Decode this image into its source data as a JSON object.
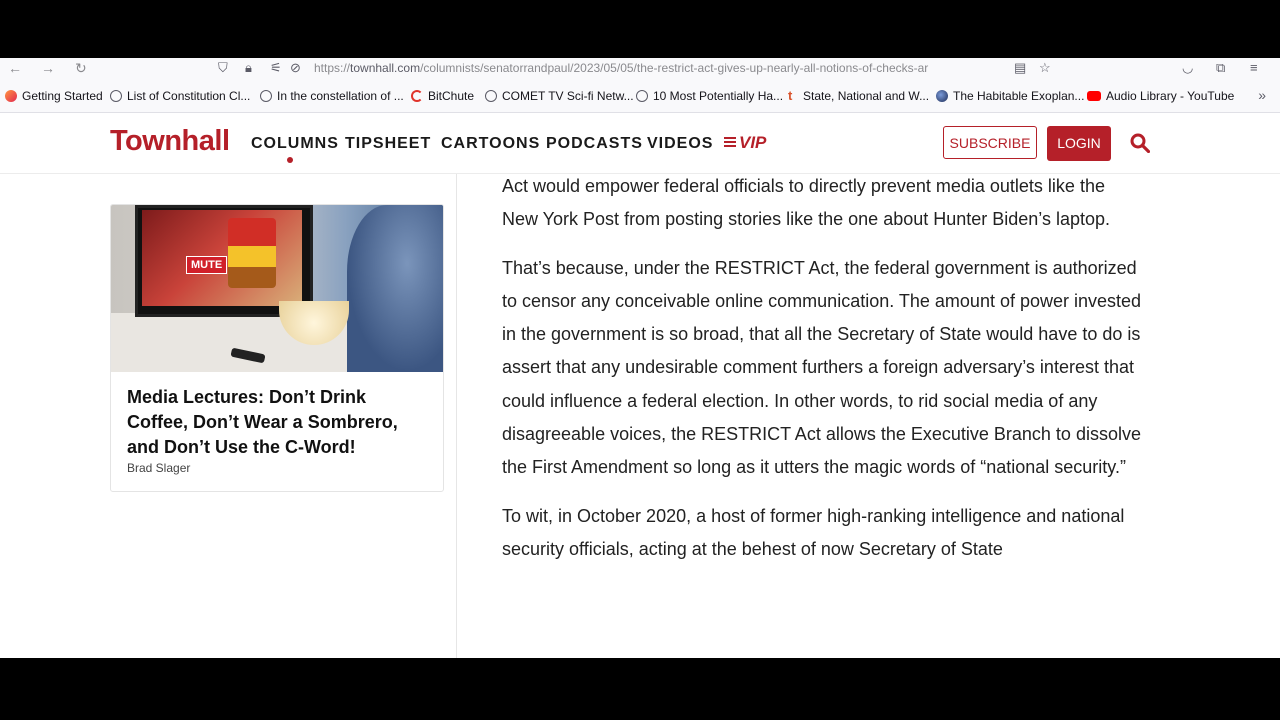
{
  "browser": {
    "url_prefix": "https://",
    "url_host": "townhall.com",
    "url_path": "/columnists/senatorrandpaul/2023/05/05/the-restrict-act-gives-up-nearly-all-notions-of-checks-ar",
    "bookmarks": [
      {
        "label": "Getting Started",
        "icon": "firefox-icon"
      },
      {
        "label": "List of Constitution Cl...",
        "icon": "globe-icon"
      },
      {
        "label": "In the constellation of ...",
        "icon": "globe-icon"
      },
      {
        "label": "BitChute",
        "icon": "bitchute-icon"
      },
      {
        "label": "COMET TV Sci-fi Netw...",
        "icon": "globe-icon"
      },
      {
        "label": "10 Most Potentially Ha...",
        "icon": "globe-icon"
      },
      {
        "label": "State, National and W...",
        "icon": "townhall-t-icon"
      },
      {
        "label": "The Habitable Exoplan...",
        "icon": "planet-icon"
      },
      {
        "label": "Audio Library - YouTube",
        "icon": "youtube-icon"
      }
    ]
  },
  "site": {
    "logo": "Townhall",
    "nav": [
      "COLUMNS",
      "TIPSHEET",
      "CARTOONS",
      "PODCASTS",
      "VIDEOS"
    ],
    "vip": "VIP",
    "subscribe": "SUBSCRIBE",
    "login": "LOGIN",
    "accent": "#b52029"
  },
  "sidebar": {
    "card": {
      "mute_label": "MUTE",
      "title": "Media Lectures: Don’t Drink Coffee, Don’t Wear a Sombrero, and Don’t Use the C-Word!",
      "author": "Brad Slager"
    }
  },
  "article": {
    "paragraphs": [
      "Act would empower federal officials to directly prevent media outlets like the New York Post from posting stories like the one about Hunter Biden’s laptop.",
      "That’s because, under the RESTRICT Act, the federal government is authorized to censor any conceivable online communication. The amount of power invested in the government is so broad, that all the Secretary of State would have to do is assert that any undesirable comment furthers a foreign adversary’s interest that could influence a federal election. In other words, to rid social media of any disagreeable voices, the RESTRICT Act allows the Executive Branch to dissolve the First Amendment so long as it utters the magic words of “national security.”",
      "To wit, in October 2020, a host of former high-ranking intelligence and national security officials, acting at the behest of now Secretary of State"
    ]
  }
}
